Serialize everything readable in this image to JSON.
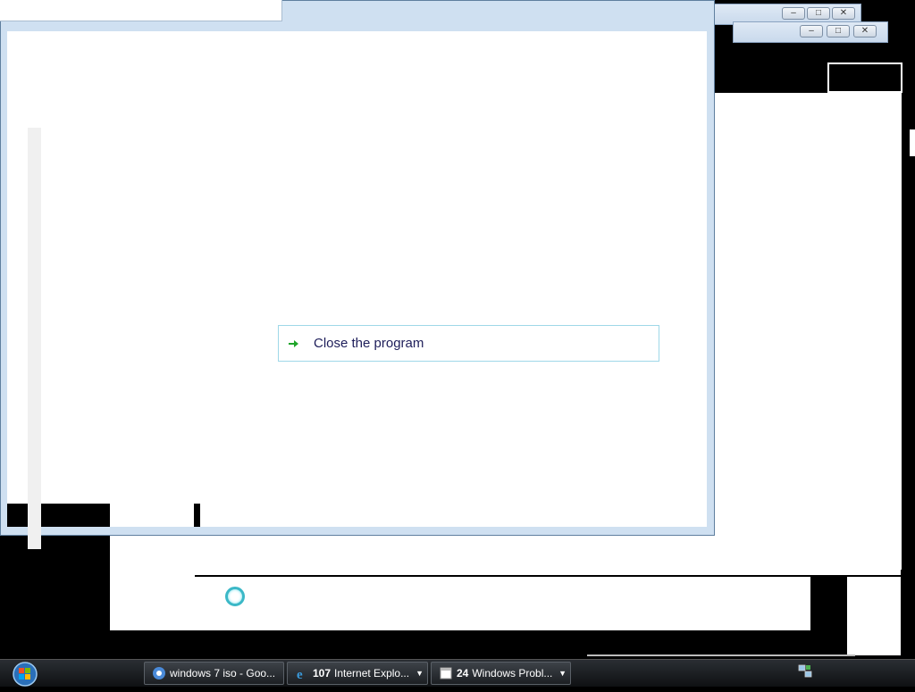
{
  "dialog": {
    "command_link_label": "Close the program"
  },
  "background_windows": [
    {
      "buttons": [
        "minimize",
        "maximize",
        "close"
      ]
    },
    {
      "buttons": [
        "minimize",
        "maximize",
        "close"
      ]
    }
  ],
  "taskbar": {
    "start_button": "Start",
    "items": [
      {
        "icon": "chrome-icon",
        "count": "",
        "label": "windows 7 iso - Goo..."
      },
      {
        "icon": "internet-explorer-icon",
        "count": "107",
        "label": "Internet Explo..."
      },
      {
        "icon": "window-icon",
        "count": "24",
        "label": "Windows Probl..."
      }
    ],
    "tray_icons": [
      "network-icon"
    ]
  },
  "colors": {
    "accent_link_border": "#9fd8e8",
    "arrow_green": "#1fa52a",
    "taskbar": "#1c1f23"
  }
}
